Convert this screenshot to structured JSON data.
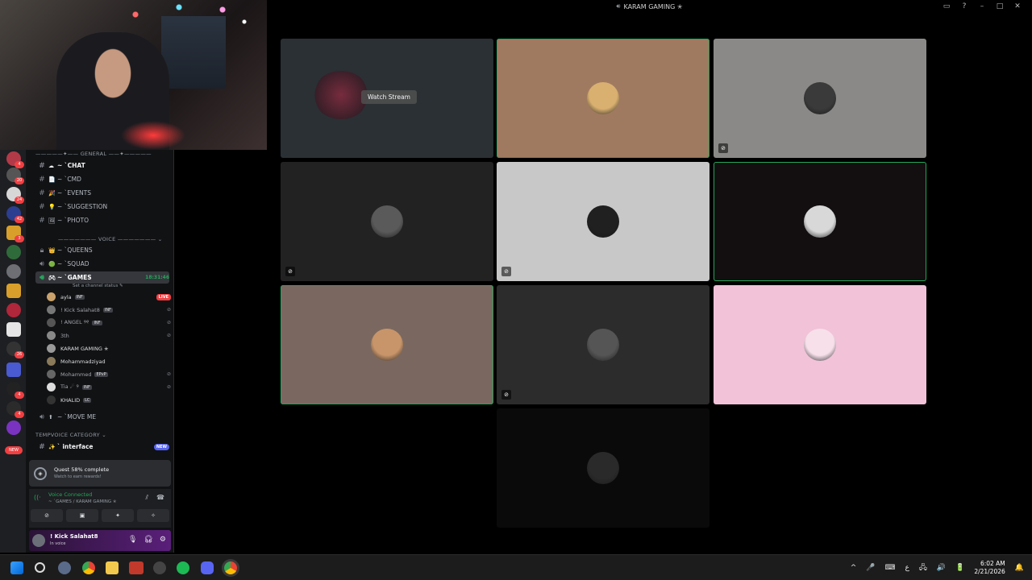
{
  "window": {
    "title": "KARAM GAMING ✭",
    "controls": [
      "▭",
      "?",
      "–",
      "□",
      "✕"
    ]
  },
  "server_badges": [
    "4",
    "20",
    "24",
    "42",
    "3",
    "26",
    "4",
    "4"
  ],
  "new_label": "NEW",
  "sidebar": {
    "general_label": "—————✦—— GENERAL ——✦—————",
    "voice_label": "——————— VOICE ——————— ⌄",
    "tempvoice_label": "TEMPVOICE CATEGORY ⌄",
    "text_channels": [
      {
        "name": "~ ˋCHAT",
        "emoji": "☁"
      },
      {
        "name": "~ ˋCMD",
        "emoji": "📄"
      },
      {
        "name": "~ ˋEVENTS",
        "emoji": "🎉"
      },
      {
        "name": "~ ˋSUGGESTION",
        "emoji": "💡"
      },
      {
        "name": "~ ˋPHOTO",
        "emoji": "🖼"
      }
    ],
    "voice_channels": [
      {
        "name": "~ ˋQUEENS",
        "emoji": "👑"
      },
      {
        "name": "~ ˋSQUAD",
        "emoji": "🟢"
      }
    ],
    "active_channel": {
      "name": "~ ˋGAMES",
      "timer": "18:31:46",
      "status": "Set a channel status ✎"
    },
    "voice_users": [
      {
        "name": "ayla",
        "tag": "INF",
        "right": "LIVE",
        "color": "#c9a26b"
      },
      {
        "name": "! Kick Salahat8",
        "tag": "INF",
        "right": "⊘",
        "color": "#777"
      },
      {
        "name": "! ANGEL ୨୧",
        "tag": "INF",
        "right": "⊘",
        "color": "#555"
      },
      {
        "name": "3th",
        "tag": "",
        "right": "⊘",
        "color": "#888"
      },
      {
        "name": "KARAM GAMING ✭",
        "tag": "",
        "right": "",
        "color": "#999"
      },
      {
        "name": "Mohammadziyad",
        "tag": "",
        "right": "",
        "color": "#8a7a5a"
      },
      {
        "name": "Mohammed",
        "tag": "EPvP",
        "right": "⊘",
        "color": "#666"
      },
      {
        "name": "Tia ☄︎ ୨",
        "tag": "INF",
        "right": "⊘",
        "color": "#ddd"
      },
      {
        "name": "KHALID",
        "tag": "LC",
        "right": "",
        "color": "#333"
      }
    ],
    "move_me": "~ ˋMOVE ME",
    "interface": {
      "name": "ˋ interface",
      "badge": "NEW"
    }
  },
  "quest": {
    "title": "Quest 58% complete",
    "subtitle": "Watch to earn rewards!",
    "progress": 0.58
  },
  "voice_connected": {
    "label": "Voice Connected",
    "location": "~ ˋGAMES / KARAM GAMING ✭"
  },
  "voice_buttons": [
    "⊘",
    "▣",
    "✦",
    "✧"
  ],
  "user": {
    "name": "! Kick Salahat8",
    "status": "In voice"
  },
  "grid": {
    "watch_stream": "Watch Stream",
    "tiles": [
      {
        "bg": "#2a3034",
        "speaking": false,
        "muted": false,
        "stream": true,
        "av": "#8a2b40"
      },
      {
        "bg": "#a07a60",
        "speaking": true,
        "muted": false,
        "stream": false,
        "av": "#d9b070"
      },
      {
        "bg": "#8a8987",
        "speaking": false,
        "muted": true,
        "stream": false,
        "av": "#3a3a3a"
      },
      {
        "bg": "#222222",
        "speaking": false,
        "muted": true,
        "stream": false,
        "av": "#5a5a5a"
      },
      {
        "bg": "#c8c8c8",
        "speaking": false,
        "muted": true,
        "stream": false,
        "av": "#202020"
      },
      {
        "bg": "#130f10",
        "speaking": true,
        "muted": false,
        "stream": false,
        "av": "#d8d8d8"
      },
      {
        "bg": "#7a6860",
        "speaking": true,
        "muted": false,
        "stream": false,
        "av": "#c8956a"
      },
      {
        "bg": "#2c2c2c",
        "speaking": false,
        "muted": true,
        "stream": false,
        "av": "#555"
      },
      {
        "bg": "#f1c2d8",
        "speaking": false,
        "muted": false,
        "stream": false,
        "av": "#f7e0ea"
      },
      {
        "bg": "#0a0a0a",
        "speaking": false,
        "muted": false,
        "stream": false,
        "av": "#2a2a2a"
      }
    ]
  },
  "taskbar": {
    "lang": "ع",
    "time": "6:02 AM",
    "date": "2/21/2026",
    "tray_icons": [
      "^",
      "🎤",
      "⌨",
      "ع",
      "🖧",
      "🔊",
      "🔋",
      "🔔"
    ]
  },
  "colors": {
    "accent_green": "#23a55a",
    "discord_red": "#f23f42",
    "blurple": "#5865f2"
  }
}
